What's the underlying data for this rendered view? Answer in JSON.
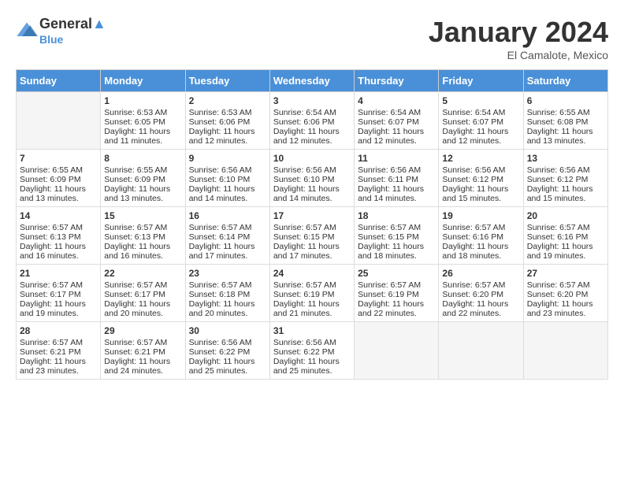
{
  "header": {
    "logo_line1": "General",
    "logo_line2": "Blue",
    "month_title": "January 2024",
    "location": "El Camalote, Mexico"
  },
  "days_of_week": [
    "Sunday",
    "Monday",
    "Tuesday",
    "Wednesday",
    "Thursday",
    "Friday",
    "Saturday"
  ],
  "weeks": [
    [
      {
        "day": "",
        "sunrise": "",
        "sunset": "",
        "daylight": "",
        "empty": true
      },
      {
        "day": "1",
        "sunrise": "6:53 AM",
        "sunset": "6:05 PM",
        "daylight": "11 hours and 11 minutes."
      },
      {
        "day": "2",
        "sunrise": "6:53 AM",
        "sunset": "6:06 PM",
        "daylight": "11 hours and 12 minutes."
      },
      {
        "day": "3",
        "sunrise": "6:54 AM",
        "sunset": "6:06 PM",
        "daylight": "11 hours and 12 minutes."
      },
      {
        "day": "4",
        "sunrise": "6:54 AM",
        "sunset": "6:07 PM",
        "daylight": "11 hours and 12 minutes."
      },
      {
        "day": "5",
        "sunrise": "6:54 AM",
        "sunset": "6:07 PM",
        "daylight": "11 hours and 12 minutes."
      },
      {
        "day": "6",
        "sunrise": "6:55 AM",
        "sunset": "6:08 PM",
        "daylight": "11 hours and 13 minutes."
      }
    ],
    [
      {
        "day": "7",
        "sunrise": "6:55 AM",
        "sunset": "6:09 PM",
        "daylight": "11 hours and 13 minutes."
      },
      {
        "day": "8",
        "sunrise": "6:55 AM",
        "sunset": "6:09 PM",
        "daylight": "11 hours and 13 minutes."
      },
      {
        "day": "9",
        "sunrise": "6:56 AM",
        "sunset": "6:10 PM",
        "daylight": "11 hours and 14 minutes."
      },
      {
        "day": "10",
        "sunrise": "6:56 AM",
        "sunset": "6:10 PM",
        "daylight": "11 hours and 14 minutes."
      },
      {
        "day": "11",
        "sunrise": "6:56 AM",
        "sunset": "6:11 PM",
        "daylight": "11 hours and 14 minutes."
      },
      {
        "day": "12",
        "sunrise": "6:56 AM",
        "sunset": "6:12 PM",
        "daylight": "11 hours and 15 minutes."
      },
      {
        "day": "13",
        "sunrise": "6:56 AM",
        "sunset": "6:12 PM",
        "daylight": "11 hours and 15 minutes."
      }
    ],
    [
      {
        "day": "14",
        "sunrise": "6:57 AM",
        "sunset": "6:13 PM",
        "daylight": "11 hours and 16 minutes."
      },
      {
        "day": "15",
        "sunrise": "6:57 AM",
        "sunset": "6:13 PM",
        "daylight": "11 hours and 16 minutes."
      },
      {
        "day": "16",
        "sunrise": "6:57 AM",
        "sunset": "6:14 PM",
        "daylight": "11 hours and 17 minutes."
      },
      {
        "day": "17",
        "sunrise": "6:57 AM",
        "sunset": "6:15 PM",
        "daylight": "11 hours and 17 minutes."
      },
      {
        "day": "18",
        "sunrise": "6:57 AM",
        "sunset": "6:15 PM",
        "daylight": "11 hours and 18 minutes."
      },
      {
        "day": "19",
        "sunrise": "6:57 AM",
        "sunset": "6:16 PM",
        "daylight": "11 hours and 18 minutes."
      },
      {
        "day": "20",
        "sunrise": "6:57 AM",
        "sunset": "6:16 PM",
        "daylight": "11 hours and 19 minutes."
      }
    ],
    [
      {
        "day": "21",
        "sunrise": "6:57 AM",
        "sunset": "6:17 PM",
        "daylight": "11 hours and 19 minutes."
      },
      {
        "day": "22",
        "sunrise": "6:57 AM",
        "sunset": "6:17 PM",
        "daylight": "11 hours and 20 minutes."
      },
      {
        "day": "23",
        "sunrise": "6:57 AM",
        "sunset": "6:18 PM",
        "daylight": "11 hours and 20 minutes."
      },
      {
        "day": "24",
        "sunrise": "6:57 AM",
        "sunset": "6:19 PM",
        "daylight": "11 hours and 21 minutes."
      },
      {
        "day": "25",
        "sunrise": "6:57 AM",
        "sunset": "6:19 PM",
        "daylight": "11 hours and 22 minutes."
      },
      {
        "day": "26",
        "sunrise": "6:57 AM",
        "sunset": "6:20 PM",
        "daylight": "11 hours and 22 minutes."
      },
      {
        "day": "27",
        "sunrise": "6:57 AM",
        "sunset": "6:20 PM",
        "daylight": "11 hours and 23 minutes."
      }
    ],
    [
      {
        "day": "28",
        "sunrise": "6:57 AM",
        "sunset": "6:21 PM",
        "daylight": "11 hours and 23 minutes."
      },
      {
        "day": "29",
        "sunrise": "6:57 AM",
        "sunset": "6:21 PM",
        "daylight": "11 hours and 24 minutes."
      },
      {
        "day": "30",
        "sunrise": "6:56 AM",
        "sunset": "6:22 PM",
        "daylight": "11 hours and 25 minutes."
      },
      {
        "day": "31",
        "sunrise": "6:56 AM",
        "sunset": "6:22 PM",
        "daylight": "11 hours and 25 minutes."
      },
      {
        "day": "",
        "sunrise": "",
        "sunset": "",
        "daylight": "",
        "empty": true
      },
      {
        "day": "",
        "sunrise": "",
        "sunset": "",
        "daylight": "",
        "empty": true
      },
      {
        "day": "",
        "sunrise": "",
        "sunset": "",
        "daylight": "",
        "empty": true
      }
    ]
  ],
  "labels": {
    "sunrise_prefix": "Sunrise: ",
    "sunset_prefix": "Sunset: ",
    "daylight_prefix": "Daylight: "
  }
}
